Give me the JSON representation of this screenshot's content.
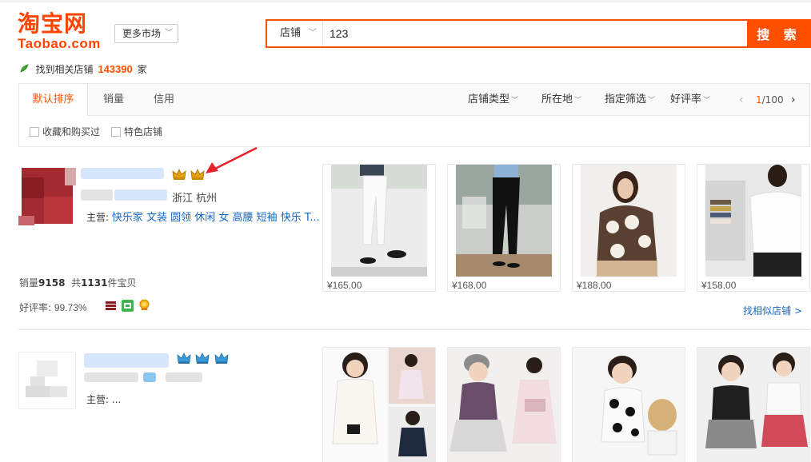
{
  "header": {
    "logo_cn": "淘宝网",
    "logo_en": "Taobao.com",
    "market_label": "更多市场",
    "search_type": "店铺",
    "search_value": "123",
    "search_button": "搜 索"
  },
  "result": {
    "prefix": "找到相关店铺",
    "count": "143390",
    "suffix": "家"
  },
  "sort": {
    "tabs": [
      "默认排序",
      "销量",
      "信用"
    ],
    "active": 0,
    "filters": [
      "店铺类型",
      "所在地",
      "指定筛选",
      "好评率"
    ],
    "page_current": "1",
    "page_total": "/100",
    "checkboxes": [
      "收藏和购买过",
      "特色店铺"
    ]
  },
  "shops": [
    {
      "location": "浙江 杭州",
      "main_label": "主营:",
      "main_cats": "快乐家 文装 圆领 休闲 女 高腰 短袖 快乐 T...",
      "sales_label": "销量",
      "sales_value": "9158",
      "items_prefix": "共",
      "items_value": "1131",
      "items_suffix": "件宝贝",
      "rating_label": "好评率:",
      "rating_value": "99.73%",
      "similar_link": "找相似店铺 >",
      "crowns": 2,
      "products": [
        {
          "price": "¥165.00"
        },
        {
          "price": "¥168.00"
        },
        {
          "price": "¥188.00"
        },
        {
          "price": "¥158.00"
        }
      ]
    },
    {
      "main_label": "主营:",
      "main_cats": "...",
      "crowns": 3
    }
  ],
  "colors": {
    "brand": "#ff5000",
    "link": "#1768c4",
    "crown_gold": "#e2a010",
    "crown_blue": "#3a9ad9"
  }
}
